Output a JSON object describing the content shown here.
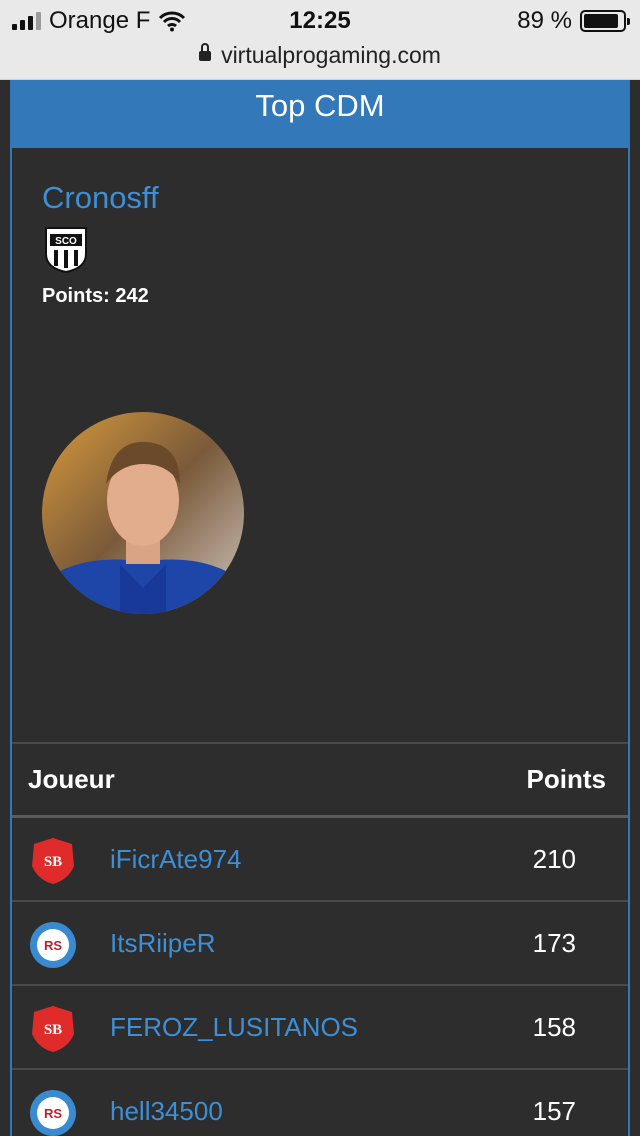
{
  "status": {
    "carrier": "Orange F",
    "time": "12:25",
    "battery": "89 %",
    "battery_level": 0.89,
    "url": "virtualprogaming.com"
  },
  "panel": {
    "title": "Top CDM",
    "featured": {
      "name": "Cronosff",
      "club_crest": "angers-sco-crest",
      "points_label": "Points:",
      "points_value": "242"
    }
  },
  "table": {
    "headers": {
      "player": "Joueur",
      "points": "Points"
    },
    "rows": [
      {
        "name": "iFicrAte974",
        "points": "210",
        "club_logo": "stade-brestois-logo"
      },
      {
        "name": "ItsRiipeR",
        "points": "173",
        "club_logo": "rc-strasbourg-logo"
      },
      {
        "name": "FEROZ_LUSITANOS",
        "points": "158",
        "club_logo": "stade-brestois-logo"
      },
      {
        "name": "hell34500",
        "points": "157",
        "club_logo": "rc-strasbourg-logo"
      }
    ]
  },
  "colors": {
    "accent": "#3378b8",
    "link": "#3d8fd6",
    "background": "#2d2d2d"
  }
}
